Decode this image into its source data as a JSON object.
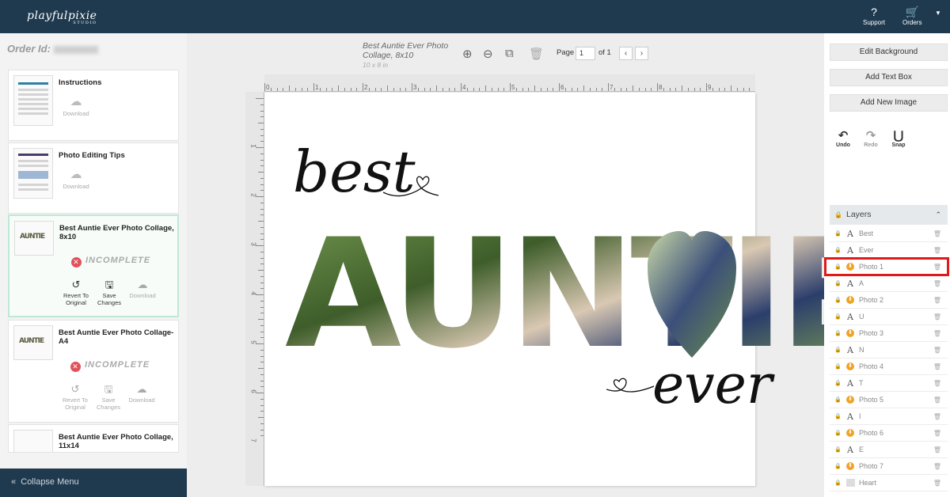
{
  "header": {
    "logo_text": "playfulpixie",
    "logo_sub": "STUDIO",
    "support_label": "Support",
    "orders_label": "Orders",
    "support_icon": "question-circle-icon",
    "orders_icon": "cart-icon"
  },
  "sidebar": {
    "order_id_label": "Order Id:",
    "items": [
      {
        "title": "Instructions",
        "download_label": "Download"
      },
      {
        "title": "Photo Editing Tips",
        "download_label": "Download"
      },
      {
        "title": "Best Auntie Ever Photo Collage, 8x10",
        "status": "INCOMPLETE",
        "revert_label": "Revert To Original",
        "save_label": "Save Changes",
        "download_label": "Download"
      },
      {
        "title": "Best Auntie Ever Photo Collage- A4",
        "status": "INCOMPLETE",
        "revert_label": "Revert To Original",
        "save_label": "Save Changes",
        "download_label": "Download"
      },
      {
        "title": "Best Auntie Ever Photo Collage, 11x14"
      }
    ],
    "collapse_label": "Collapse Menu",
    "thumb_word": "AUNTIE"
  },
  "canvas": {
    "title": "Best Auntie Ever Photo Collage, 8x10",
    "size_label": "10 x 8 in",
    "page_label": "Page",
    "page_value": "1",
    "page_of": "of 1",
    "ruler_top": [
      "0",
      "1",
      "2",
      "3",
      "4",
      "5",
      "6",
      "7",
      "8",
      "9"
    ],
    "ruler_left": [
      "1",
      "2",
      "3",
      "4",
      "5",
      "6",
      "7"
    ],
    "word_best": "best",
    "word_auntie": "AUNTIE",
    "word_ever": "ever"
  },
  "right_panel": {
    "edit_background": "Edit Background",
    "add_text_box": "Add Text Box",
    "add_new_image": "Add New Image",
    "undo_label": "Undo",
    "redo_label": "Redo",
    "snap_label": "Snap",
    "layers_title": "Layers",
    "layers": [
      {
        "name": "Best",
        "kind": "text"
      },
      {
        "name": "Ever",
        "kind": "text"
      },
      {
        "name": "Photo 1",
        "kind": "image"
      },
      {
        "name": "A",
        "kind": "text"
      },
      {
        "name": "Photo 2",
        "kind": "image"
      },
      {
        "name": "U",
        "kind": "text"
      },
      {
        "name": "Photo 3",
        "kind": "image"
      },
      {
        "name": "N",
        "kind": "text"
      },
      {
        "name": "Photo 4",
        "kind": "image"
      },
      {
        "name": "T",
        "kind": "text"
      },
      {
        "name": "Photo 5",
        "kind": "image"
      },
      {
        "name": "I",
        "kind": "text"
      },
      {
        "name": "Photo 6",
        "kind": "image"
      },
      {
        "name": "E",
        "kind": "text"
      },
      {
        "name": "Photo 7",
        "kind": "image"
      },
      {
        "name": "Heart",
        "kind": "shape"
      }
    ]
  },
  "colors": {
    "header_bg": "#1f3a4f",
    "incomplete": "#e2505a",
    "selected_border": "#bfe8d6",
    "image_layer": "#f0a326",
    "highlight": "#e01a1a"
  }
}
